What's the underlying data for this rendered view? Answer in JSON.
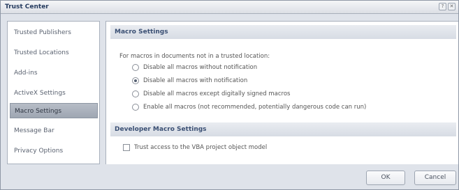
{
  "window": {
    "title": "Trust Center"
  },
  "nav": {
    "items": [
      {
        "label": "Trusted Publishers"
      },
      {
        "label": "Trusted Locations"
      },
      {
        "label": "Add-ins"
      },
      {
        "label": "ActiveX Settings"
      },
      {
        "label": "Macro Settings",
        "selected": true
      },
      {
        "label": "Message Bar"
      },
      {
        "label": "Privacy Options"
      }
    ]
  },
  "macro_settings": {
    "header": "Macro Settings",
    "intro": "For macros in documents not in a trusted location:",
    "options": [
      {
        "label": "Disable all macros without notification",
        "checked": false
      },
      {
        "label": "Disable all macros with notification",
        "checked": true
      },
      {
        "label": "Disable all macros except digitally signed macros",
        "checked": false
      },
      {
        "label": "Enable all macros (not recommended, potentially dangerous code can run)",
        "checked": false
      }
    ]
  },
  "developer_settings": {
    "header": "Developer Macro Settings",
    "checkbox_label": "Trust access to the VBA project object model",
    "checked": false
  },
  "buttons": {
    "ok": "OK",
    "cancel": "Cancel"
  }
}
